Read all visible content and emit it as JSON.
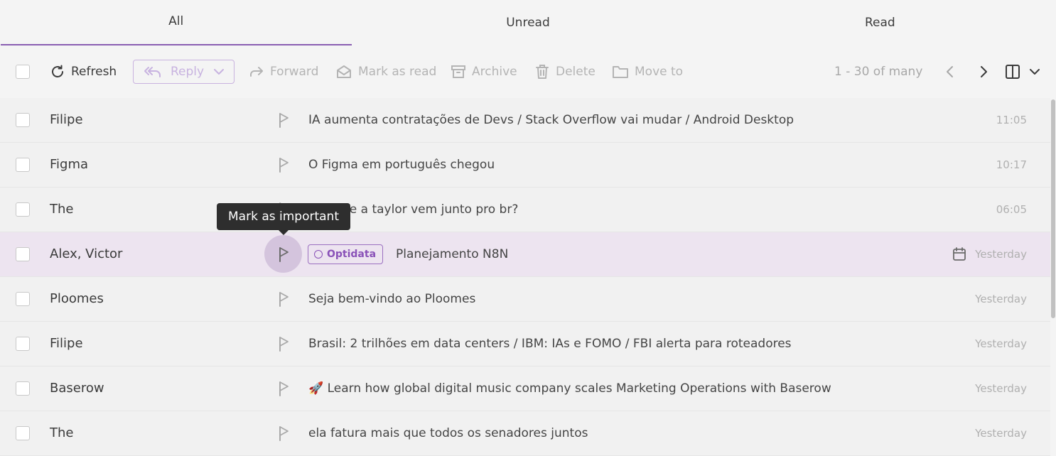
{
  "tabs": [
    {
      "label": "All",
      "active": true
    },
    {
      "label": "Unread",
      "active": false
    },
    {
      "label": "Read",
      "active": false
    }
  ],
  "toolbar": {
    "refresh_label": "Refresh",
    "reply_label": "Reply",
    "forward_label": "Forward",
    "mark_read_label": "Mark as read",
    "archive_label": "Archive",
    "delete_label": "Delete",
    "move_label": "Move to",
    "pagination": "1 - 30 of many"
  },
  "tooltip": "Mark as important",
  "emails": [
    {
      "sender": "Filipe",
      "subject": "IA aumenta contratações de Devs / Stack Overflow vai mudar / Android Desktop",
      "time": "11:05"
    },
    {
      "sender": "Figma",
      "subject": "O Figma em português chegou",
      "time": "10:17"
    },
    {
      "sender": "The",
      "subject": "ue a taylor vem junto pro br?",
      "time": "06:05"
    },
    {
      "sender": "Alex, Victor",
      "tag": "Optidata",
      "subject": "Planejamento N8N",
      "time": "Yesterday"
    },
    {
      "sender": "Ploomes",
      "subject": "Seja bem-vindo ao Ploomes",
      "time": "Yesterday"
    },
    {
      "sender": "Filipe",
      "subject": "Brasil: 2 trilhões em data centers / IBM: IAs e FOMO / FBI alerta para roteadores",
      "time": "Yesterday"
    },
    {
      "sender": "Baserow",
      "emoji": "🚀",
      "subject": "Learn how global digital music company scales Marketing Operations with Baserow",
      "time": "Yesterday"
    },
    {
      "sender": "The",
      "subject": "ela fatura mais que todos os senadores juntos",
      "time": "Yesterday"
    }
  ],
  "colors": {
    "accent": "#8a5fb2",
    "hover_row": "#ede4f0",
    "tooltip_bg": "#2e2e2e"
  }
}
